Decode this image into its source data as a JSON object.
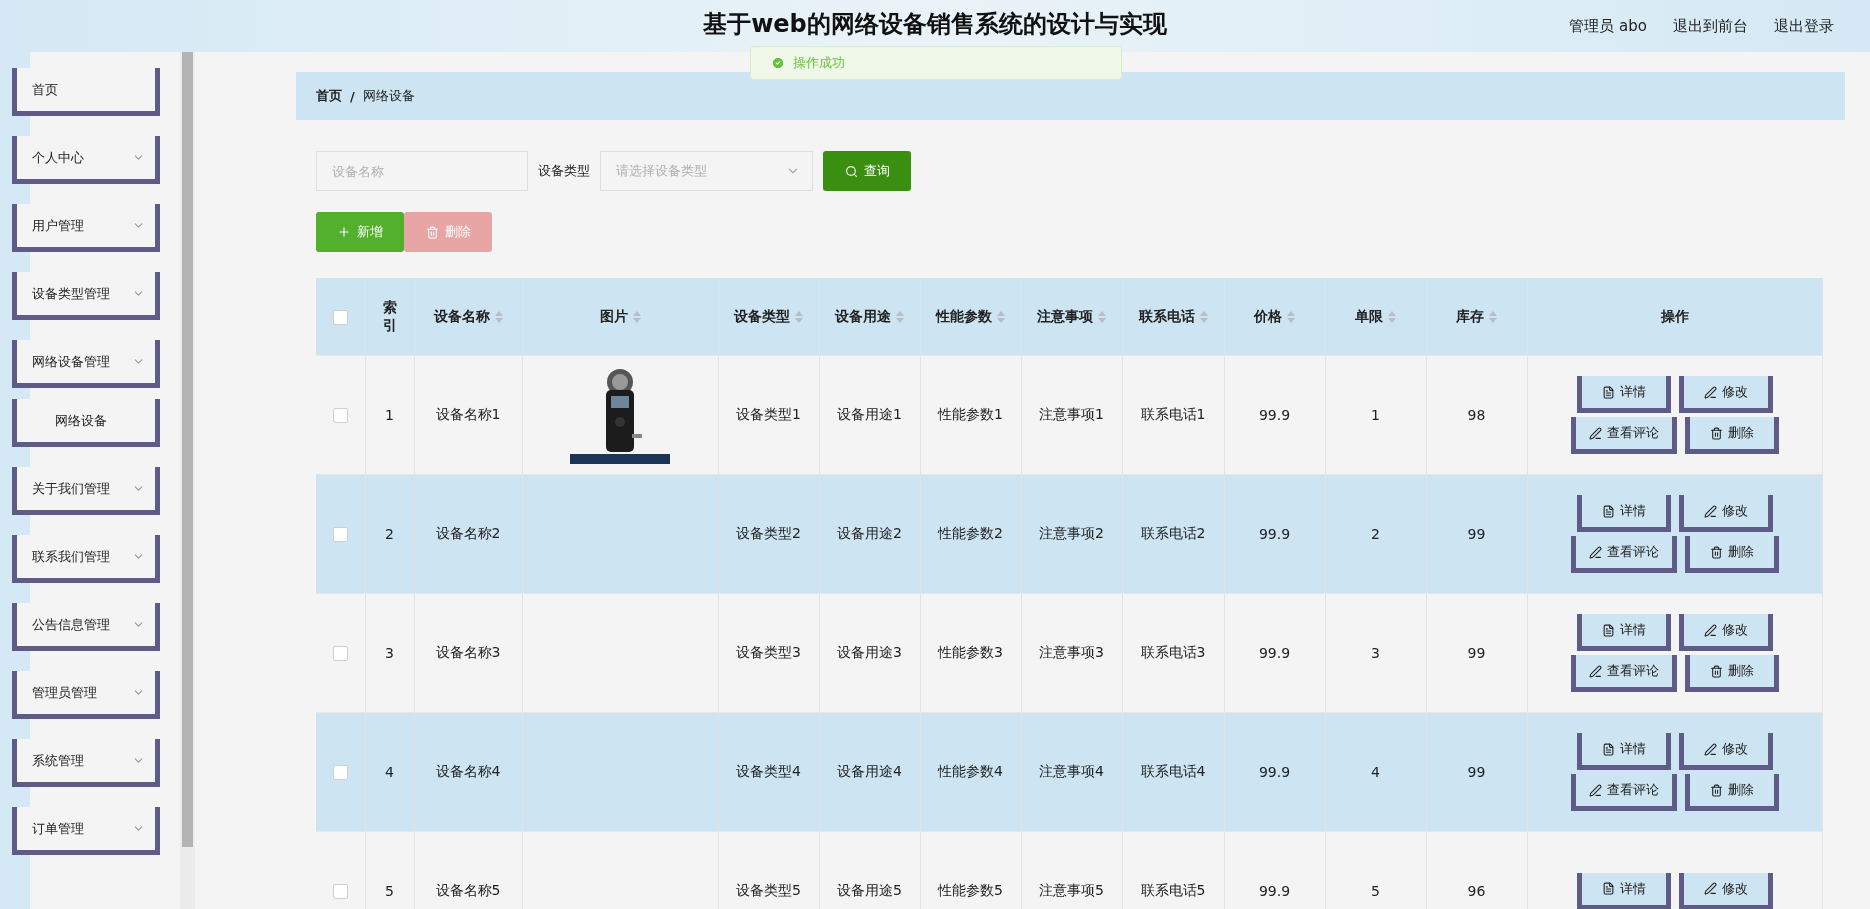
{
  "header": {
    "title": "基于web的网络设备销售系统的设计与实现",
    "user": "管理员 abo",
    "links": [
      "退出到前台",
      "退出登录"
    ]
  },
  "toast": {
    "text": "操作成功"
  },
  "sidebar": {
    "items": [
      {
        "label": "首页",
        "kind": "link"
      },
      {
        "label": "个人中心",
        "kind": "menu"
      },
      {
        "label": "用户管理",
        "kind": "menu"
      },
      {
        "label": "设备类型管理",
        "kind": "menu"
      },
      {
        "label": "网络设备管理",
        "kind": "menu",
        "children": [
          {
            "label": "网络设备"
          }
        ]
      },
      {
        "label": "关于我们管理",
        "kind": "menu"
      },
      {
        "label": "联系我们管理",
        "kind": "menu"
      },
      {
        "label": "公告信息管理",
        "kind": "menu"
      },
      {
        "label": "管理员管理",
        "kind": "menu"
      },
      {
        "label": "系统管理",
        "kind": "menu"
      },
      {
        "label": "订单管理",
        "kind": "menu"
      }
    ]
  },
  "breadcrumb": {
    "items": [
      "首页",
      "网络设备"
    ],
    "separator": "/"
  },
  "search": {
    "name_placeholder": "设备名称",
    "type_label": "设备类型",
    "type_placeholder": "请选择设备类型",
    "button": "查询"
  },
  "actions": [
    {
      "label": "新增",
      "kind": "add"
    },
    {
      "label": "删除",
      "kind": "delete",
      "disabled": true
    }
  ],
  "table": {
    "select_all": {
      "checked": false
    },
    "columns": [
      {
        "label": "索引",
        "sortable": false
      },
      {
        "label": "设备名称",
        "sortable": true
      },
      {
        "label": "图片",
        "sortable": true
      },
      {
        "label": "设备类型",
        "sortable": true
      },
      {
        "label": "设备用途",
        "sortable": true
      },
      {
        "label": "性能参数",
        "sortable": true
      },
      {
        "label": "注意事项",
        "sortable": true
      },
      {
        "label": "联系电话",
        "sortable": true
      },
      {
        "label": "价格",
        "sortable": true
      },
      {
        "label": "单限",
        "sortable": true
      },
      {
        "label": "库存",
        "sortable": true
      },
      {
        "label": "操作",
        "sortable": false
      }
    ],
    "rows": [
      {
        "selected": false,
        "index": "1",
        "name": "设备名称1",
        "image": {
          "kind": "picture"
        },
        "type": "设备类型1",
        "use": "设备用途1",
        "params": "性能参数1",
        "notes": "注意事项1",
        "phone": "联系电话1",
        "price": "99.9",
        "limit": "1",
        "stock": "98",
        "buttons": [
          {
            "label": "详情",
            "kind": "detail"
          },
          {
            "label": "修改",
            "kind": "edit"
          },
          {
            "label": "查看评论",
            "kind": "comment"
          },
          {
            "label": "删除",
            "kind": "delete"
          }
        ]
      },
      {
        "selected": false,
        "index": "2",
        "name": "设备名称2",
        "type": "设备类型2",
        "use": "设备用途2",
        "params": "性能参数2",
        "notes": "注意事项2",
        "phone": "联系电话2",
        "price": "99.9",
        "limit": "2",
        "stock": "99",
        "buttons": [
          {
            "label": "详情",
            "kind": "detail"
          },
          {
            "label": "修改",
            "kind": "edit"
          },
          {
            "label": "查看评论",
            "kind": "comment"
          },
          {
            "label": "删除",
            "kind": "delete"
          }
        ]
      },
      {
        "selected": false,
        "index": "3",
        "name": "设备名称3",
        "type": "设备类型3",
        "use": "设备用途3",
        "params": "性能参数3",
        "notes": "注意事项3",
        "phone": "联系电话3",
        "price": "99.9",
        "limit": "3",
        "stock": "99",
        "buttons": [
          {
            "label": "详情",
            "kind": "detail"
          },
          {
            "label": "修改",
            "kind": "edit"
          },
          {
            "label": "查看评论",
            "kind": "comment"
          },
          {
            "label": "删除",
            "kind": "delete"
          }
        ]
      },
      {
        "selected": false,
        "index": "4",
        "name": "设备名称4",
        "type": "设备类型4",
        "use": "设备用途4",
        "params": "性能参数4",
        "notes": "注意事项4",
        "phone": "联系电话4",
        "price": "99.9",
        "limit": "4",
        "stock": "99",
        "buttons": [
          {
            "label": "详情",
            "kind": "detail"
          },
          {
            "label": "修改",
            "kind": "edit"
          },
          {
            "label": "查看评论",
            "kind": "comment"
          },
          {
            "label": "删除",
            "kind": "delete"
          }
        ]
      },
      {
        "selected": false,
        "index": "5",
        "name": "设备名称5",
        "type": "设备类型5",
        "use": "设备用途5",
        "params": "性能参数5",
        "notes": "注意事项5",
        "phone": "联系电话5",
        "price": "99.9",
        "limit": "5",
        "stock": "96",
        "buttons": [
          {
            "label": "详情",
            "kind": "detail"
          },
          {
            "label": "修改",
            "kind": "edit"
          }
        ]
      }
    ]
  }
}
